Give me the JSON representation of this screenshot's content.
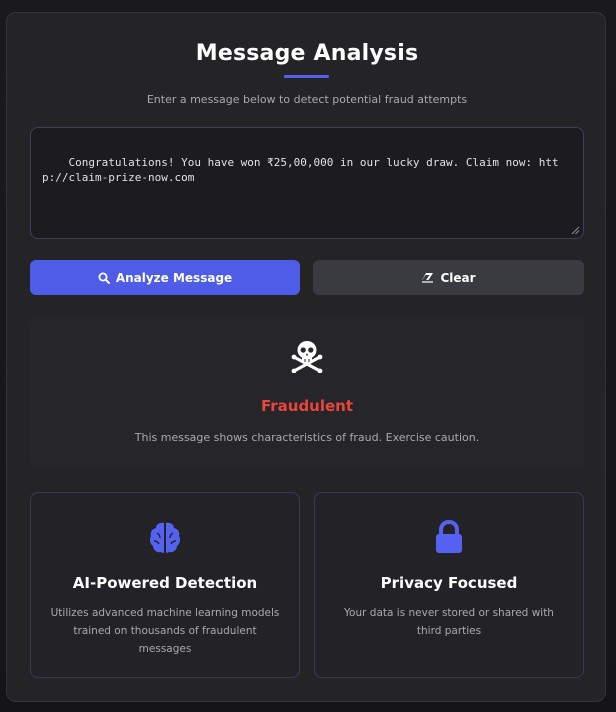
{
  "header": {
    "title": "Message Analysis",
    "subtitle": "Enter a message below to detect potential fraud attempts"
  },
  "message_input": {
    "value": "Congratulations! You have won ₹25,00,000 in our lucky draw. Claim now: http://claim-prize-now.com"
  },
  "actions": {
    "analyze_label": "Analyze Message",
    "analyze_icon": "search-icon",
    "clear_label": "Clear",
    "clear_icon": "eraser-icon"
  },
  "result": {
    "icon": "skull-crossbones-icon",
    "verdict": "Fraudulent",
    "verdict_color": "#e8453c",
    "description": "This message shows characteristics of fraud. Exercise caution."
  },
  "features": [
    {
      "icon": "brain-icon",
      "title": "AI-Powered Detection",
      "description": "Utilizes advanced machine learning models trained on thousands of fraudulent messages"
    },
    {
      "icon": "lock-icon",
      "title": "Privacy Focused",
      "description": "Your data is never stored or shared with third parties"
    }
  ],
  "colors": {
    "accent": "#4f5ce8",
    "danger": "#e8453c",
    "card_bg": "#242427"
  }
}
